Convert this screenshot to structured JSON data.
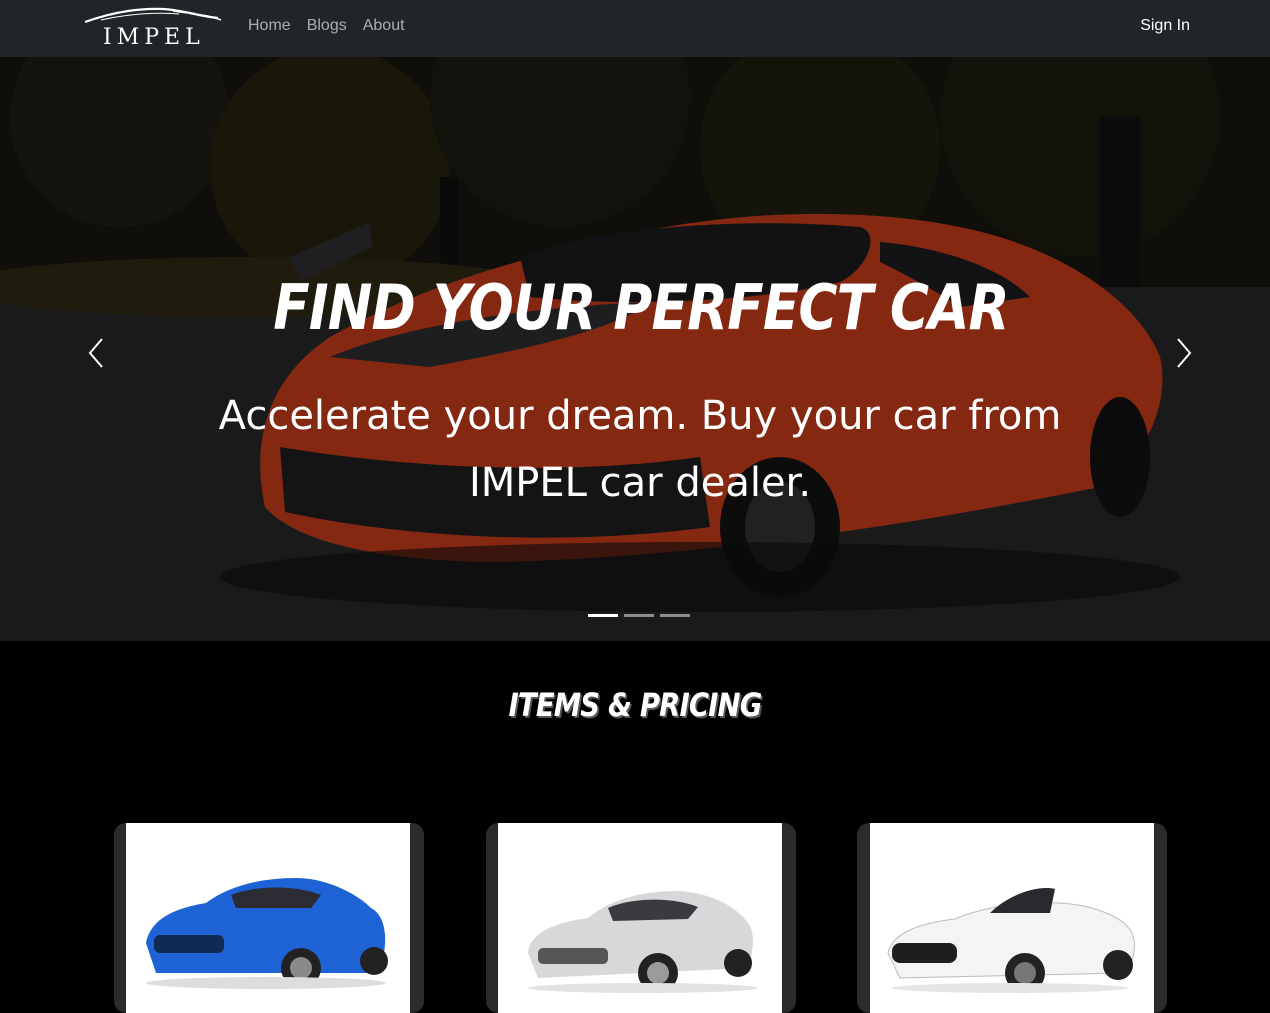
{
  "brand": {
    "name": "IMPEL"
  },
  "nav": {
    "links": [
      "Home",
      "Blogs",
      "About"
    ],
    "sign_in": "Sign In"
  },
  "hero": {
    "title": "FIND YOUR PERFECT CAR",
    "subtitle": "Accelerate your dream. Buy your car from IMPEL car dealer.",
    "slides": 3,
    "active_slide": 1,
    "prev_icon": "chevron-left-icon",
    "next_icon": "chevron-right-icon"
  },
  "pricing": {
    "title": "ITEMS & PRICING",
    "cards": [
      {
        "image": "blue-sports-coupe",
        "color": "#1565d8"
      },
      {
        "image": "silver-sports-coupe",
        "color": "#d9d9d9"
      },
      {
        "image": "white-convertible",
        "color": "#f2f2f2"
      }
    ]
  },
  "colors": {
    "navbar": "#212529",
    "page_bg": "#000000",
    "hero_car": "#d2421a"
  }
}
